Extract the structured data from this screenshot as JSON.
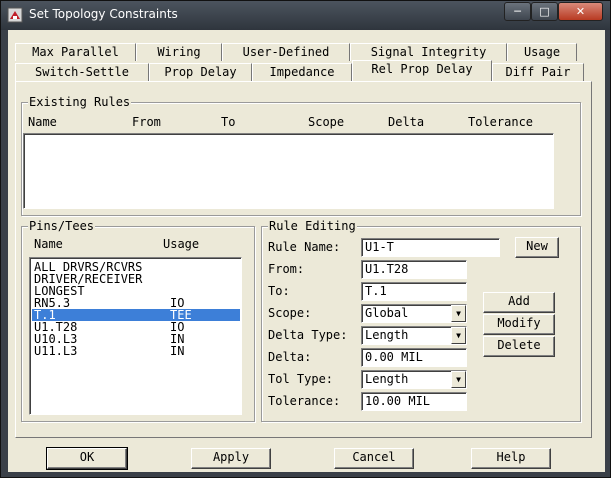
{
  "window": {
    "title": "Set Topology Constraints"
  },
  "tabs_back": [
    {
      "label": "Max Parallel"
    },
    {
      "label": "Wiring"
    },
    {
      "label": "User-Defined"
    },
    {
      "label": "Signal Integrity"
    },
    {
      "label": "Usage"
    }
  ],
  "tabs_front": [
    {
      "label": "Switch-Settle"
    },
    {
      "label": "Prop Delay"
    },
    {
      "label": "Impedance"
    },
    {
      "label": "Rel Prop Delay"
    },
    {
      "label": "Diff Pair"
    }
  ],
  "existing_rules": {
    "label": "Existing Rules",
    "columns": [
      "Name",
      "From",
      "To",
      "Scope",
      "Delta",
      "Tolerance"
    ]
  },
  "pins_tees": {
    "label": "Pins/Tees",
    "columns": [
      "Name",
      "Usage"
    ],
    "rows": [
      {
        "name": "ALL DRVRS/RCVRS",
        "usage": ""
      },
      {
        "name": "DRIVER/RECEIVER",
        "usage": ""
      },
      {
        "name": "LONGEST",
        "usage": ""
      },
      {
        "name": "RN5.3",
        "usage": "IO"
      },
      {
        "name": "T.1",
        "usage": "TEE"
      },
      {
        "name": "U1.T28",
        "usage": "IO"
      },
      {
        "name": "U10.L3",
        "usage": "IN"
      },
      {
        "name": "U11.L3",
        "usage": "IN"
      }
    ]
  },
  "rule_editing": {
    "label": "Rule Editing",
    "rule_name_label": "Rule Name:",
    "rule_name_value": "U1-T",
    "from_label": "From:",
    "from_value": "U1.T28",
    "to_label": "To:",
    "to_value": "T.1",
    "scope_label": "Scope:",
    "scope_value": "Global",
    "delta_type_label": "Delta Type:",
    "delta_type_value": "Length",
    "delta_label": "Delta:",
    "delta_value": "0.00 MIL",
    "tol_type_label": "Tol Type:",
    "tol_type_value": "Length",
    "tolerance_label": "Tolerance:",
    "tolerance_value": "10.00 MIL",
    "new_label": "New",
    "add_label": "Add",
    "modify_label": "Modify",
    "delete_label": "Delete"
  },
  "footer": {
    "ok_label": "OK",
    "apply_label": "Apply",
    "cancel_label": "Cancel",
    "help_label": "Help"
  }
}
